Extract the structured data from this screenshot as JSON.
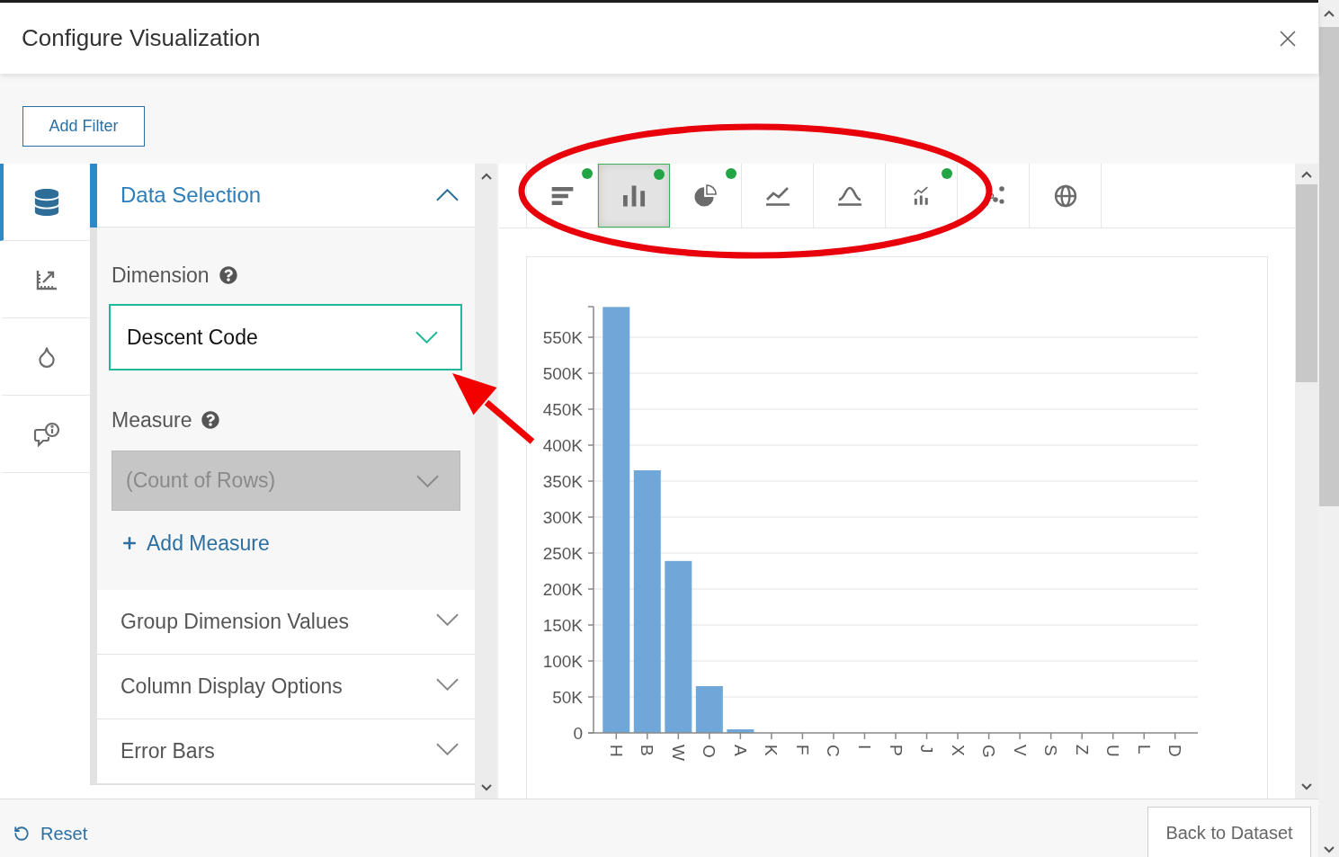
{
  "dialog": {
    "title": "Configure Visualization"
  },
  "filter_button": {
    "label": "Add Filter"
  },
  "side_rail": [
    {
      "selected": true
    },
    {
      "selected": false
    },
    {
      "selected": false
    },
    {
      "selected": false
    }
  ],
  "data_selection": {
    "title": "Data Selection",
    "expanded": true,
    "dimension": {
      "label": "Dimension",
      "value": "Descent Code",
      "focused": true
    },
    "measure": {
      "label": "Measure",
      "value": "(Count of Rows)",
      "disabled": true
    },
    "add_measure": "Add Measure"
  },
  "sections": [
    {
      "title": "Group Dimension Values",
      "expanded": false
    },
    {
      "title": "Column Display Options",
      "expanded": false
    },
    {
      "title": "Error Bars",
      "expanded": false
    }
  ],
  "chart_types": [
    {
      "selected": false,
      "dot": true
    },
    {
      "selected": true,
      "dot": true
    },
    {
      "selected": false,
      "dot": true
    },
    {
      "selected": false,
      "dot": false
    },
    {
      "selected": false,
      "dot": false
    },
    {
      "selected": false,
      "dot": true
    },
    {
      "selected": false,
      "dot": false
    },
    {
      "selected": false,
      "dot": false
    }
  ],
  "chart": {
    "chart_data": {
      "type": "bar",
      "categories": [
        "H",
        "B",
        "W",
        "O",
        "A",
        "K",
        "F",
        "C",
        "I",
        "P",
        "J",
        "X",
        "G",
        "V",
        "S",
        "Z",
        "U",
        "L",
        "D"
      ],
      "series": [
        {
          "color": "#6fa8d8",
          "values": [
            592000,
            365000,
            239000,
            65000,
            5000,
            0,
            0,
            0,
            0,
            0,
            0,
            0,
            0,
            0,
            0,
            0,
            0,
            0,
            0
          ]
        }
      ],
      "ylim": [
        0,
        592500
      ],
      "yticks": [
        {
          "value": 0,
          "label": "0"
        },
        {
          "value": 50000,
          "label": "50K"
        },
        {
          "value": 100000,
          "label": "100K"
        },
        {
          "value": 150000,
          "label": "150K"
        },
        {
          "value": 200000,
          "label": "200K"
        },
        {
          "value": 250000,
          "label": "250K"
        },
        {
          "value": 300000,
          "label": "300K"
        },
        {
          "value": 350000,
          "label": "350K"
        },
        {
          "value": 400000,
          "label": "400K"
        },
        {
          "value": 450000,
          "label": "450K"
        },
        {
          "value": 500000,
          "label": "500K"
        },
        {
          "value": 550000,
          "label": "550K"
        }
      ],
      "grid": true
    }
  },
  "footer": {
    "reset": "Reset",
    "back_button": "Back to Dataset"
  },
  "annotations": [
    {
      "kind": "ellipse"
    },
    {
      "kind": "arrow"
    }
  ]
}
